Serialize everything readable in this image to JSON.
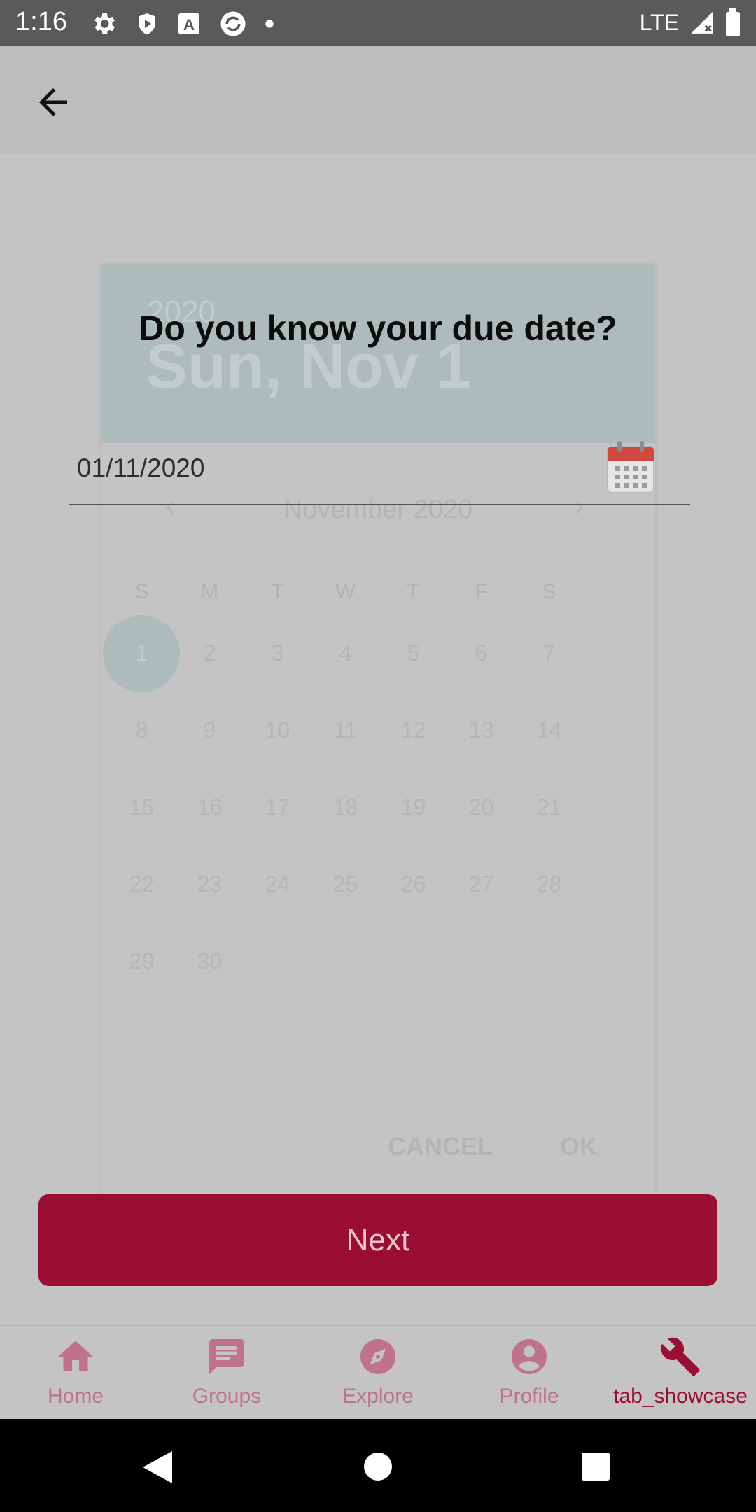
{
  "status_bar": {
    "time": "1:16",
    "network": "LTE"
  },
  "picker": {
    "year": "2020",
    "selected_date": "Sun, Nov 1",
    "month_label": "November 2020",
    "weekdays": [
      "S",
      "M",
      "T",
      "W",
      "T",
      "F",
      "S"
    ],
    "days": [
      "1",
      "2",
      "3",
      "4",
      "5",
      "6",
      "7",
      "8",
      "9",
      "10",
      "11",
      "12",
      "13",
      "14",
      "15",
      "16",
      "17",
      "18",
      "19",
      "20",
      "21",
      "22",
      "23",
      "24",
      "25",
      "26",
      "27",
      "28",
      "29",
      "30"
    ],
    "cancel_label": "CANCEL",
    "ok_label": "OK"
  },
  "question": "Do you know your due date?",
  "date_field": {
    "value": "01/11/2020"
  },
  "next_label": "Next",
  "nav": {
    "items": [
      {
        "label": "Home",
        "icon": "home-icon"
      },
      {
        "label": "Groups",
        "icon": "chat-icon"
      },
      {
        "label": "Explore",
        "icon": "compass-icon"
      },
      {
        "label": "Profile",
        "icon": "account-icon"
      },
      {
        "label": "tab_showcase",
        "icon": "wrench-icon"
      }
    ],
    "active_index": 4
  },
  "colors": {
    "accent": "#9b0e34",
    "inactive_nav": "#c0728a"
  }
}
